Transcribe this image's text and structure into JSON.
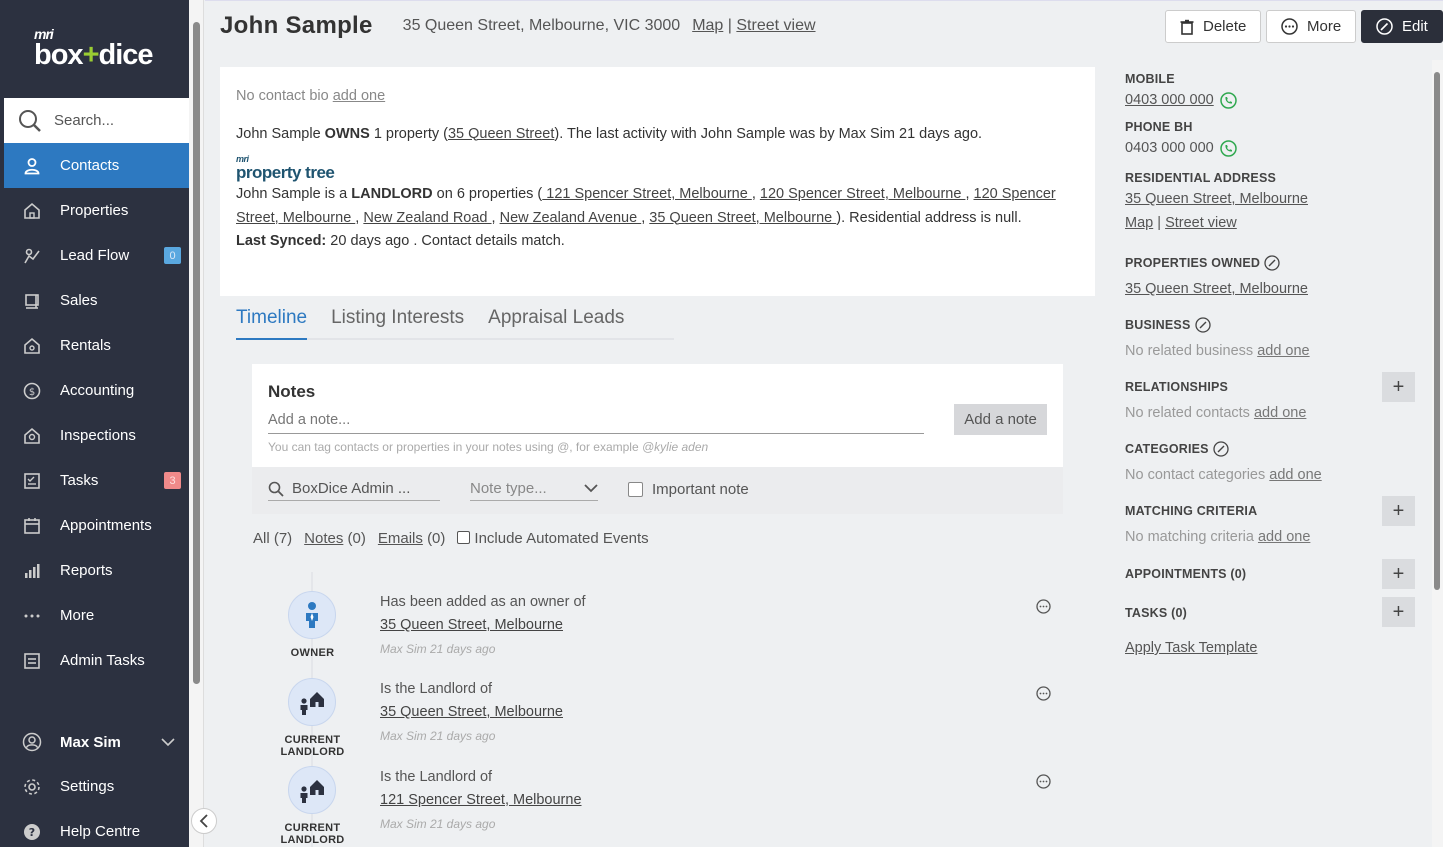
{
  "brand": {
    "mri": "mri",
    "box": "box",
    "plus": "+",
    "dice": "dice"
  },
  "search": {
    "placeholder": "Search..."
  },
  "nav": {
    "items": [
      {
        "label": "Contacts",
        "icon": "user-icon"
      },
      {
        "label": "Properties",
        "icon": "house-icon"
      },
      {
        "label": "Lead Flow",
        "icon": "lead-flow-icon",
        "badge": "0"
      },
      {
        "label": "Sales",
        "icon": "sales-icon"
      },
      {
        "label": "Rentals",
        "icon": "rentals-icon"
      },
      {
        "label": "Accounting",
        "icon": "dollar-icon"
      },
      {
        "label": "Inspections",
        "icon": "inspections-icon"
      },
      {
        "label": "Tasks",
        "icon": "tasks-icon",
        "badge": "3"
      },
      {
        "label": "Appointments",
        "icon": "calendar-icon"
      },
      {
        "label": "Reports",
        "icon": "bar-chart-icon"
      },
      {
        "label": "More",
        "icon": "ellipsis-icon"
      },
      {
        "label": "Admin Tasks",
        "icon": "admin-tasks-icon"
      }
    ],
    "user": "Max Sim",
    "settings": "Settings",
    "help": "Help Centre"
  },
  "header": {
    "name": "John Sample",
    "address": "35 Queen Street, Melbourne, VIC 3000",
    "map": "Map",
    "sep": "|",
    "street_view": "Street view",
    "delete": "Delete",
    "more": "More",
    "edit": "Edit"
  },
  "bio": {
    "no_bio": "No contact bio",
    "add_one": "add one",
    "owns_pre": "John Sample",
    "owns": "OWNS",
    "owns_mid": "1 property (",
    "owns_link": "35 Queen Street",
    "owns_post": "). The last activity with John Sample was by Max Sim 21 days ago.",
    "pt_mri": "mri",
    "pt_name": "property tree",
    "landlord_pre": "John Sample is a",
    "landlord": "LANDLORD",
    "landlord_mid": "on 6 properties (",
    "props": [
      " 121 Spencer Street, Melbourne ",
      "120 Spencer Street, Melbourne ",
      "120 Spencer Street, Melbourne ",
      "New Zealand Road ",
      "New Zealand Avenue ",
      "35 Queen Street, Melbourne "
    ],
    "landlord_post": "). Residential address is null.",
    "synced_label": "Last Synced:",
    "synced_value": "20 days ago . Contact details match."
  },
  "tabs": [
    "Timeline",
    "Listing Interests",
    "Appraisal Leads"
  ],
  "notes": {
    "title": "Notes",
    "placeholder": "Add a note...",
    "hint_pre": "You can tag contacts or properties in your notes using",
    "hint_at": "@",
    "hint_mid": ", for example",
    "hint_ex": "@kylie aden",
    "add_button": "Add a note",
    "user": "BoxDice Admin ...",
    "type_placeholder": "Note type...",
    "important": "Important note"
  },
  "filters": {
    "all": "All (7)",
    "notes_link": "Notes",
    "notes_count": "(0)",
    "emails_link": "Emails",
    "emails_count": "(0)",
    "automated": "Include Automated Events"
  },
  "timeline": [
    {
      "role": "OWNER",
      "text": "Has been added as an owner of",
      "link": "35 Queen Street, Melbourne",
      "meta": "Max Sim 21 days ago",
      "icon": "owner-icon"
    },
    {
      "role": "CURRENT LANDLORD",
      "text": "Is the Landlord of",
      "link": "35 Queen Street, Melbourne",
      "meta": "Max Sim 21 days ago",
      "icon": "landlord-icon"
    },
    {
      "role": "CURRENT LANDLORD",
      "text": "Is the Landlord of",
      "link": "121 Spencer Street, Melbourne",
      "meta": "Max Sim 21 days ago",
      "icon": "landlord-icon"
    }
  ],
  "right": {
    "mobile_label": "MOBILE",
    "mobile": "0403 000 000",
    "phone_bh_label": "PHONE BH",
    "phone_bh": "0403 000 000",
    "res_label": "RESIDENTIAL ADDRESS",
    "res_value": "35 Queen Street, Melbourne",
    "res_map": "Map",
    "res_sep": "|",
    "res_sv": "Street view",
    "props_label": "PROPERTIES OWNED",
    "props_value": "35 Queen Street, Melbourne",
    "business_label": "BUSINESS",
    "business_empty": "No related business",
    "rel_label": "RELATIONSHIPS",
    "rel_empty": "No related contacts",
    "cat_label": "CATEGORIES",
    "cat_empty": "No contact categories",
    "match_label": "MATCHING CRITERIA",
    "match_empty": "No matching criteria",
    "add_one": "add one",
    "appt_label": "APPOINTMENTS (0)",
    "tasks_label": "TASKS (0)",
    "apply_template": "Apply Task Template",
    "plus": "+"
  },
  "colors": {
    "sidebar": "#2c3140",
    "accent": "#2d79c1",
    "phone": "#2fa84f"
  }
}
